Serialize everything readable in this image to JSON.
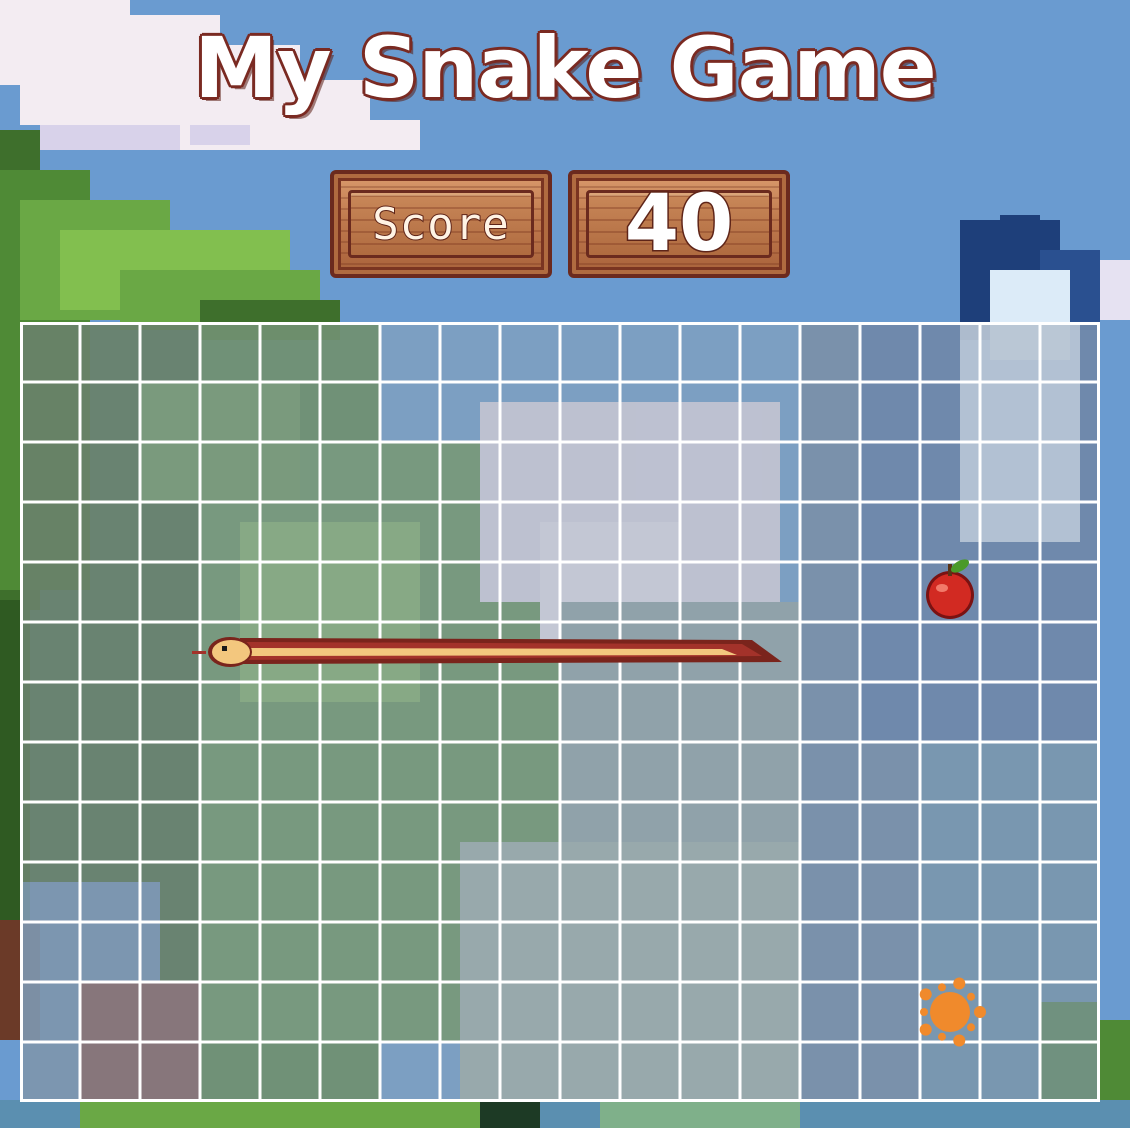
{
  "game": {
    "title": "My Snake Game",
    "score_label": "Score",
    "score_value": "40"
  },
  "board": {
    "columns": 18,
    "rows": 13,
    "grid_line_color": "#ffffff",
    "snake": {
      "direction": "left",
      "head": [
        3,
        5
      ],
      "length_cells": 10,
      "body_colors": [
        "#f3c77e",
        "#a3322a",
        "#7a241c"
      ]
    },
    "apple": {
      "cell": [
        15,
        4
      ],
      "icon": "apple-icon"
    },
    "splat": {
      "cell": [
        15,
        11
      ],
      "icon": "orange-splat-icon",
      "color": "#f08a2c"
    }
  },
  "colors": {
    "sky": "#6a9bd0",
    "title_outline": "#7a2a22",
    "wood": "#c07a4e"
  }
}
